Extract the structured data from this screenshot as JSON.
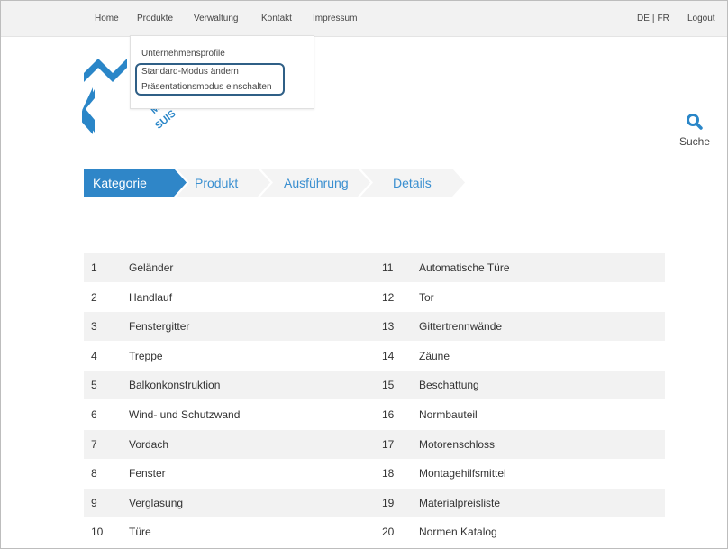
{
  "nav": {
    "items": [
      "Home",
      "Produkte",
      "Verwaltung",
      "Kontakt",
      "Impressum"
    ],
    "lang_de": "DE",
    "lang_sep": "|",
    "lang_fr": "FR",
    "logout": "Logout"
  },
  "dropdown": {
    "items": [
      "Unternehmensprofile",
      "Standard-Modus ändern",
      "Präsentationsmodus einschalten"
    ]
  },
  "logo": {
    "line1": "ME",
    "line2": "SUIS"
  },
  "search": {
    "label": "Suche",
    "icon": "search-icon"
  },
  "steps": {
    "items": [
      "Kategorie",
      "Produkt",
      "Ausführung",
      "Details"
    ],
    "active_index": 0
  },
  "categories": {
    "left": [
      {
        "num": "1",
        "name": "Geländer"
      },
      {
        "num": "2",
        "name": "Handlauf"
      },
      {
        "num": "3",
        "name": "Fenstergitter"
      },
      {
        "num": "4",
        "name": "Treppe"
      },
      {
        "num": "5",
        "name": "Balkonkonstruktion"
      },
      {
        "num": "6",
        "name": "Wind- und Schutzwand"
      },
      {
        "num": "7",
        "name": "Vordach"
      },
      {
        "num": "8",
        "name": "Fenster"
      },
      {
        "num": "9",
        "name": "Verglasung"
      },
      {
        "num": "10",
        "name": "Türe"
      }
    ],
    "right": [
      {
        "num": "11",
        "name": "Automatische Türe"
      },
      {
        "num": "12",
        "name": "Tor"
      },
      {
        "num": "13",
        "name": "Gittertrennwände"
      },
      {
        "num": "14",
        "name": "Zäune"
      },
      {
        "num": "15",
        "name": "Beschattung"
      },
      {
        "num": "16",
        "name": "Normbauteil"
      },
      {
        "num": "17",
        "name": "Motorenschloss"
      },
      {
        "num": "18",
        "name": "Montagehilfsmittel"
      },
      {
        "num": "19",
        "name": "Materialpreisliste"
      },
      {
        "num": "20",
        "name": "Normen Katalog"
      }
    ]
  },
  "colors": {
    "accent": "#2f86c8",
    "step_inactive_bg": "#f4f4f4",
    "step_inactive_text": "#3a8fd0",
    "row_shade": "#f2f2f2",
    "highlight_border": "#2f5f86"
  }
}
